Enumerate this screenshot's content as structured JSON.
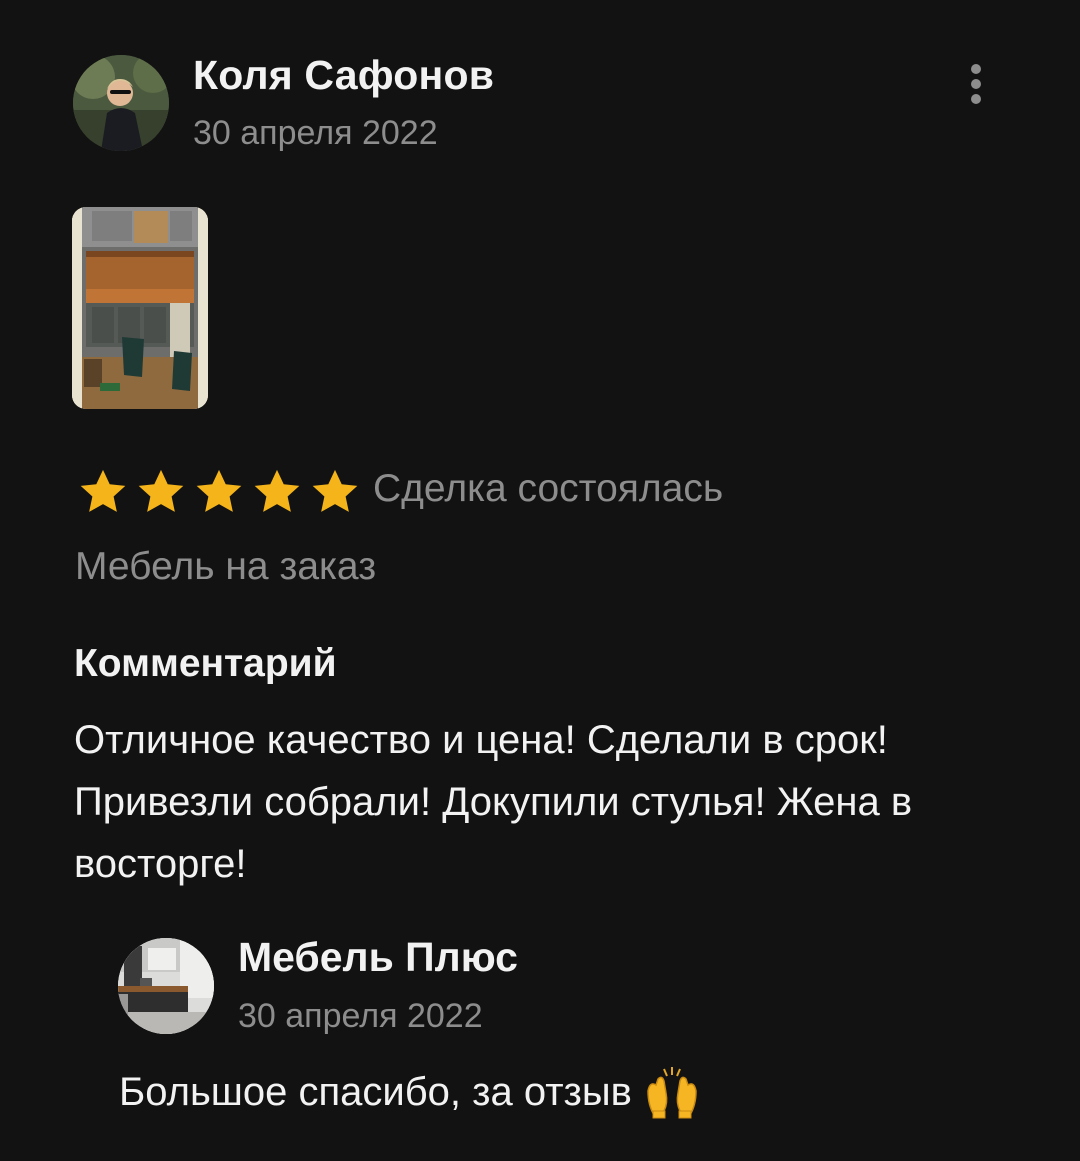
{
  "review": {
    "author": {
      "name": "Коля Сафонов",
      "date": "30 апреля 2022",
      "avatar_icon": "user-photo-avatar"
    },
    "menu_icon": "more-vertical-icon",
    "photo": {
      "icon": "kitchen-photo-thumbnail"
    },
    "rating": {
      "stars": 5,
      "max": 5,
      "star_color": "#f4b41a"
    },
    "deal_status": "Сделка состоялась",
    "category": "Мебель на заказ",
    "comment_heading": "Комментарий",
    "comment_text": "Отличное качество и цена! Сделали в срок! Привезли собрали! Докупили стулья! Жена в восторге!"
  },
  "reply": {
    "author": {
      "name": "Мебель Плюс",
      "date": "30 апреля 2022",
      "avatar_icon": "kitchen-logo-avatar"
    },
    "text": "Большое спасибо, за отзыв",
    "emoji_icon": "raising-hands-emoji"
  },
  "colors": {
    "background": "#121212",
    "text_primary": "#f2f2f2",
    "text_secondary": "#8d8d8d",
    "star": "#f4b41a"
  }
}
